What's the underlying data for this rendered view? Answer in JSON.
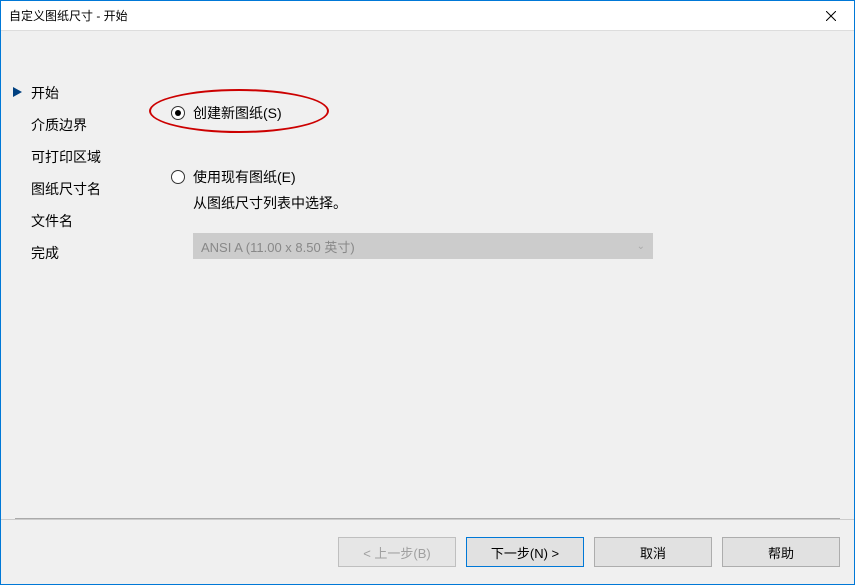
{
  "titlebar": {
    "title": "自定义图纸尺寸 - 开始"
  },
  "sidebar": {
    "items": [
      {
        "label": "开始"
      },
      {
        "label": "介质边界"
      },
      {
        "label": "可打印区域"
      },
      {
        "label": "图纸尺寸名"
      },
      {
        "label": "文件名"
      },
      {
        "label": "完成"
      }
    ]
  },
  "main": {
    "radio_create": "创建新图纸(S)",
    "radio_existing": "使用现有图纸(E)",
    "subtext": "从图纸尺寸列表中选择。",
    "dropdown_value": "ANSI A (11.00 x 8.50 英寸)"
  },
  "footer": {
    "back": "< 上一步(B)",
    "next": "下一步(N) >",
    "cancel": "取消",
    "help": "帮助"
  }
}
